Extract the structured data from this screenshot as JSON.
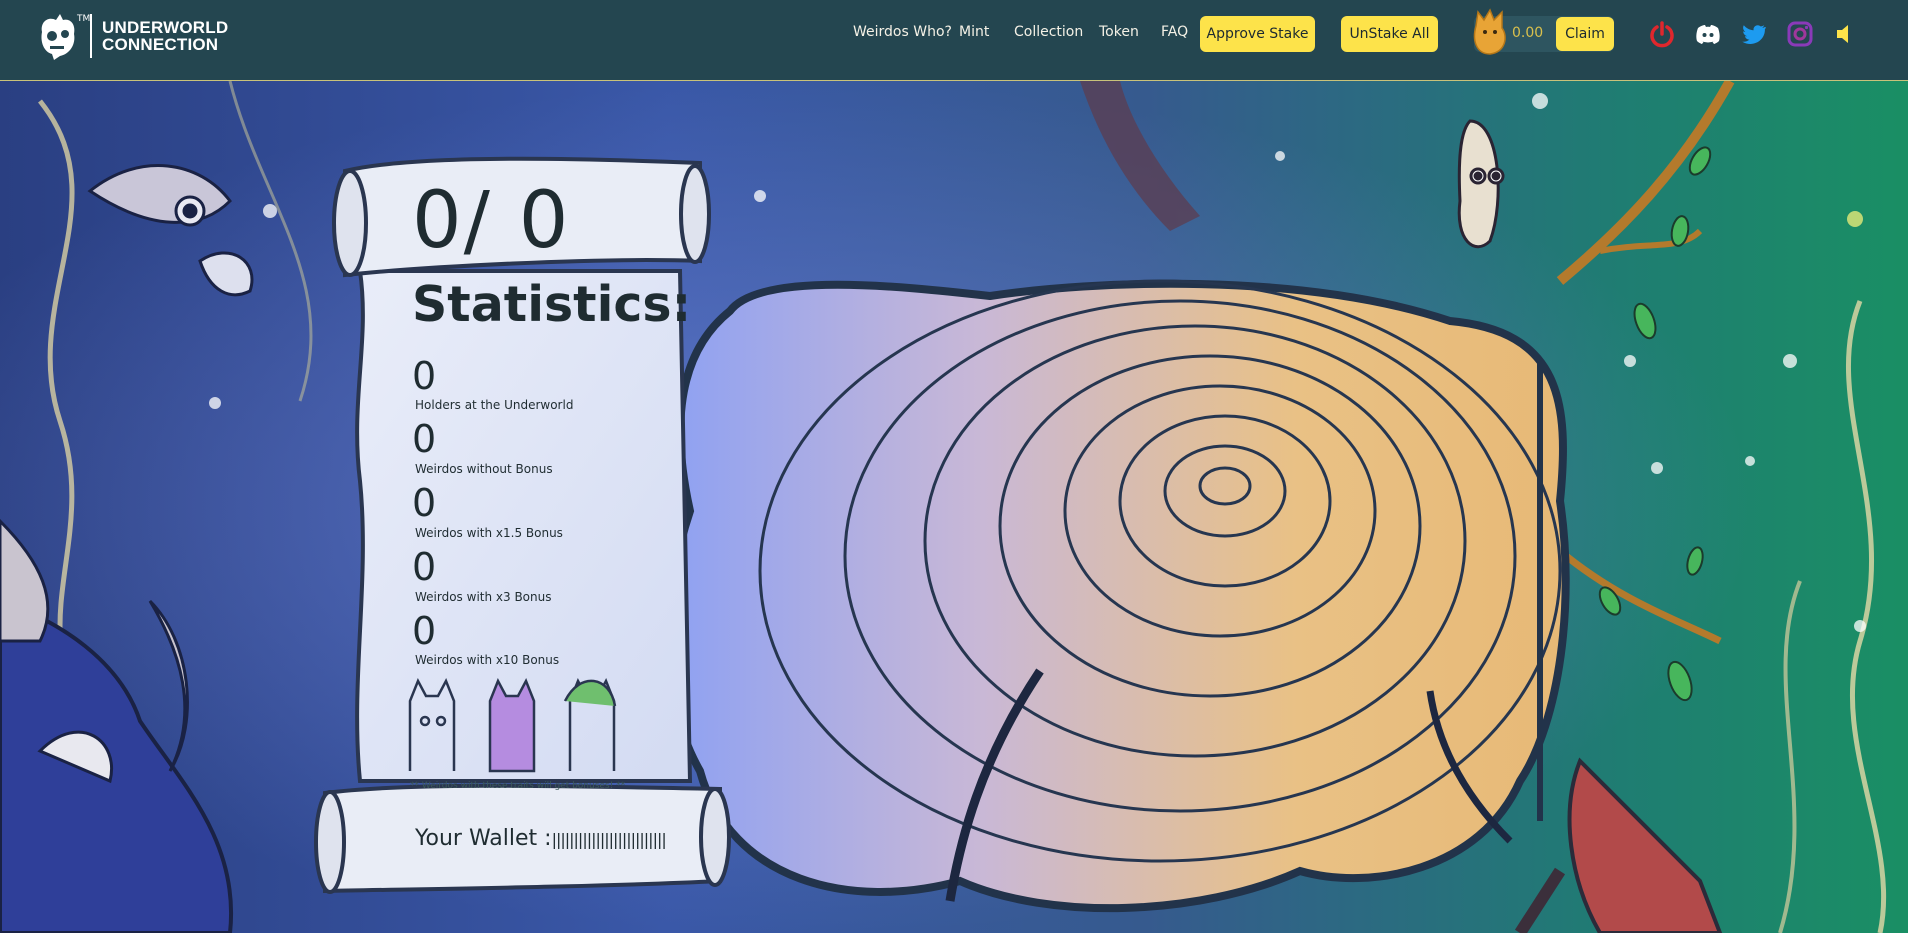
{
  "header": {
    "logo_text_line1": "UNDERWORLD",
    "logo_text_line2": "CONNECTION",
    "logo_tm": "TM",
    "nav": [
      "Weirdos Who?",
      "Mint",
      "Collection",
      "Token",
      "FAQ"
    ],
    "approve_stake": "Approve Stake",
    "unstake_all": "UnStake All",
    "balance": "0.00",
    "claim": "Claim",
    "icons": [
      "power-icon",
      "discord-icon",
      "twitter-icon",
      "instagram-icon",
      "speaker-icon"
    ]
  },
  "scroll": {
    "counter": "0/ 0",
    "title": "Statistics:",
    "stats": [
      {
        "value": "0",
        "label": "Holders at the Underworld"
      },
      {
        "value": "0",
        "label": "Weirdos without Bonus"
      },
      {
        "value": "0",
        "label": "Weirdos with x1.5 Bonus"
      },
      {
        "value": "0",
        "label": "Weirdos with x3 Bonus"
      },
      {
        "value": "0",
        "label": "Weirdos with x10 Bonus"
      }
    ],
    "traits_note": "** Weirdos with these traits will get bonuses! **",
    "wallet_label": "Your Wallet :",
    "wallet_value": "||||||||||||||||||||||||||"
  },
  "colors": {
    "topbar": "#244650",
    "accent_yellow": "#fde34a",
    "power": "#e0272d",
    "twitter": "#1d9bf0",
    "instagram": "#8a3ab9",
    "balance_text": "#d9c04c"
  }
}
